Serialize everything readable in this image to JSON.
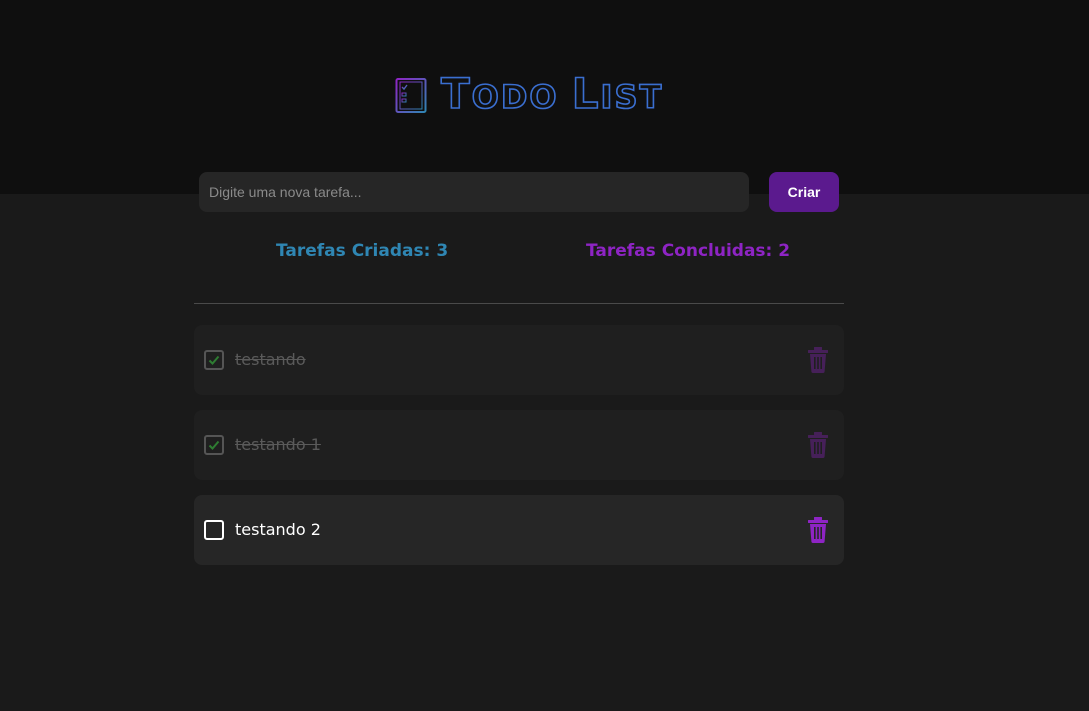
{
  "app": {
    "title": "Todo List",
    "logo_big_1": "T",
    "logo_small_1": "ODO ",
    "logo_big_2": "L",
    "logo_small_2": "IST"
  },
  "input": {
    "placeholder": "Digite uma nova tarefa...",
    "value": ""
  },
  "create_button": {
    "label": "Criar"
  },
  "counters": {
    "created": "Tarefas Criadas: 3",
    "completed": "Tarefas Concluidas: 2"
  },
  "tasks": [
    {
      "label": "testando",
      "completed": true
    },
    {
      "label": "testando 1",
      "completed": true
    },
    {
      "label": "testando 2",
      "completed": false
    }
  ],
  "colors": {
    "accent": "#5b1a8e",
    "created_counter": "#2f86b3",
    "completed_counter": "#8e24c4",
    "trash": "#8e24c4",
    "check": "#2e7d32"
  },
  "icons": {
    "logo": "checklist-icon",
    "task_check": "check-icon",
    "delete": "trash-icon"
  }
}
